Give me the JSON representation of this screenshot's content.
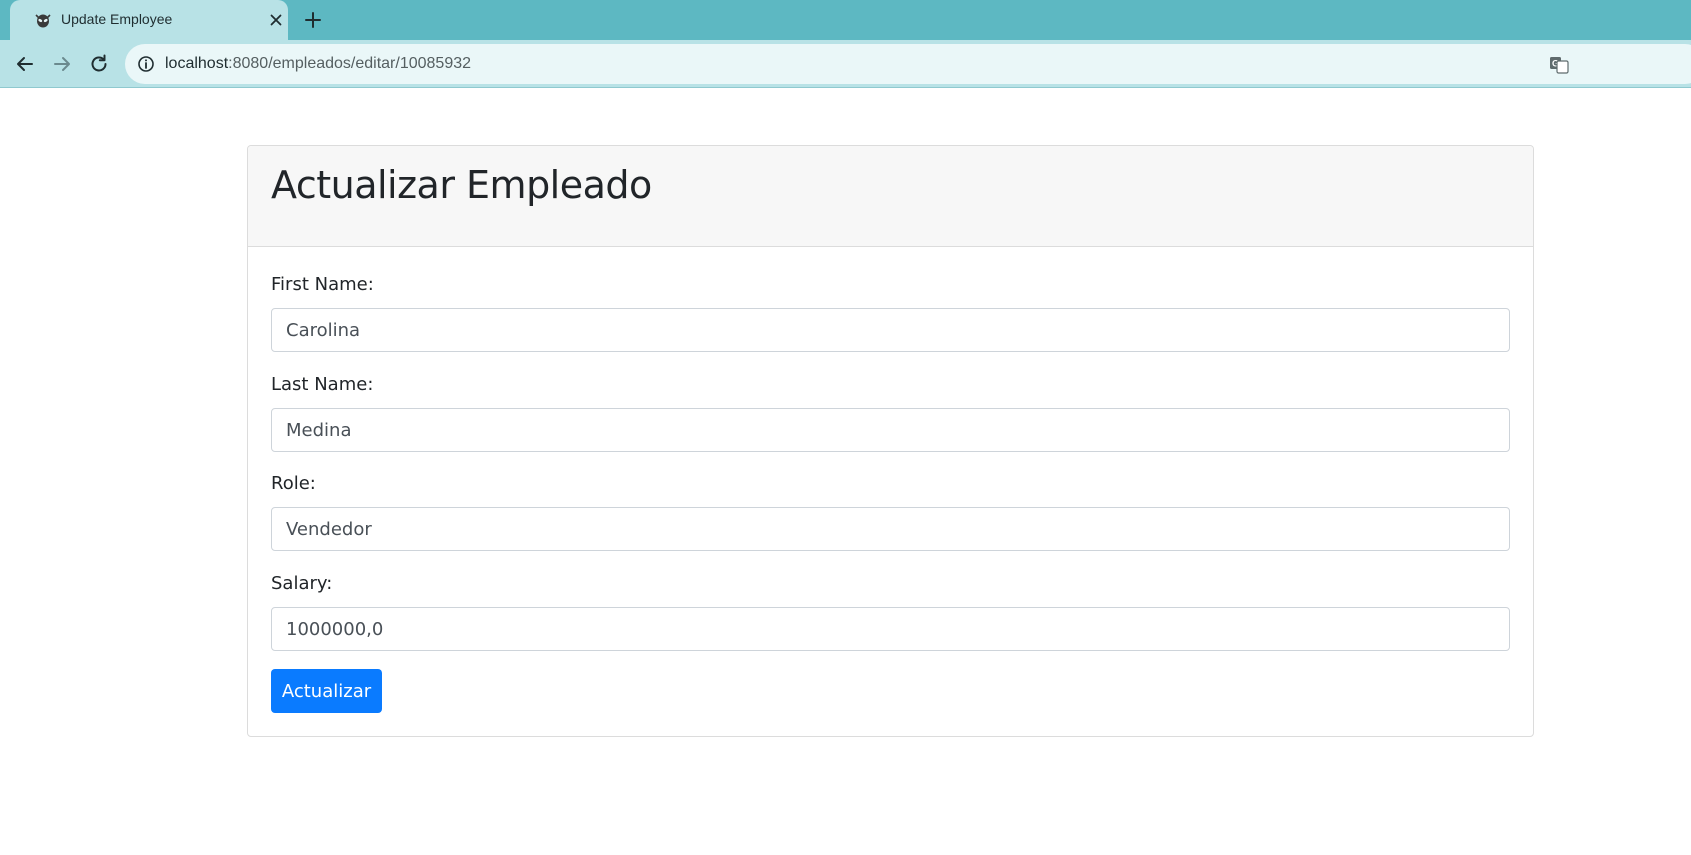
{
  "browser": {
    "tab_title": "Update Employee",
    "url_host": "localhost",
    "url_path": ":8080/empleados/editar/10085932"
  },
  "page": {
    "title": "Actualizar Empleado",
    "fields": {
      "first_name": {
        "label": "First Name:",
        "value": "Carolina"
      },
      "last_name": {
        "label": "Last Name:",
        "value": "Medina"
      },
      "role": {
        "label": "Role:",
        "value": "Vendedor"
      },
      "salary": {
        "label": "Salary:",
        "value": "1000000,0"
      }
    },
    "submit_label": "Actualizar"
  },
  "colors": {
    "tabstrip": "#5db8c2",
    "toolbar": "#b8e2e6",
    "primary_button": "#0a7bff"
  },
  "icons": {
    "favicon": "alien-icon",
    "close": "close-icon",
    "new_tab": "plus-icon",
    "back": "arrow-left-icon",
    "forward": "arrow-right-icon",
    "reload": "reload-icon",
    "site_info": "info-icon",
    "translate": "translate-icon"
  }
}
